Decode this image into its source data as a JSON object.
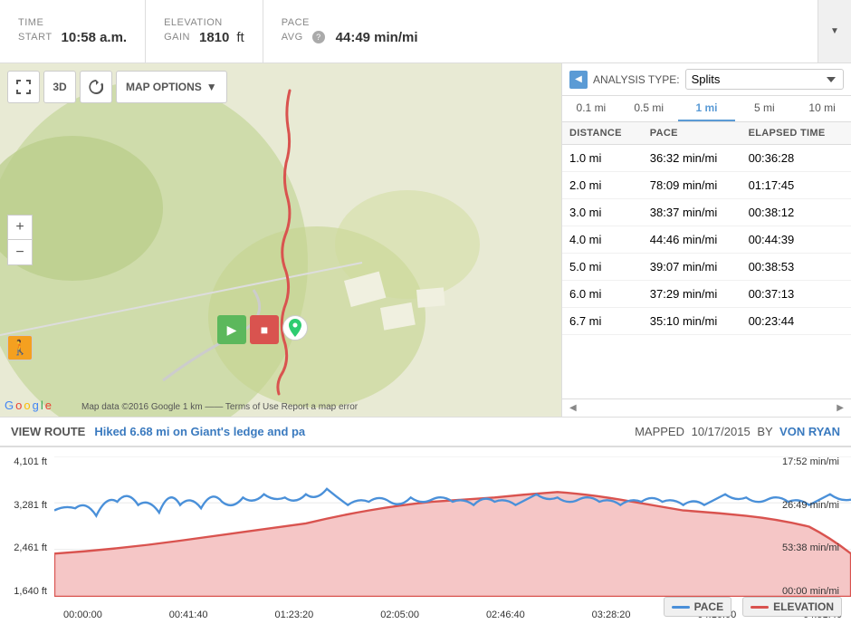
{
  "header": {
    "time_label": "TIME",
    "start_label": "START",
    "start_value": "10:58 a.m.",
    "elevation_label": "ELEVATION",
    "gain_label": "GAIN",
    "gain_value": "1810",
    "gain_unit": "ft",
    "pace_label": "PACE",
    "avg_label": "AVG",
    "avg_value": "44:49 min/mi"
  },
  "map": {
    "options_label": "MAP OPTIONS",
    "copyright": "Map data ©2016 Google   1 km ——   Terms of Use   Report a map error"
  },
  "splits": {
    "title": "Splits",
    "analysis_label": "ANALYSIS TYPE:",
    "tabs": [
      "0.1 mi",
      "0.5 mi",
      "1 mi",
      "5 mi",
      "10 mi"
    ],
    "active_tab": 2,
    "columns": [
      "DISTANCE",
      "PACE",
      "ELAPSED TIME"
    ],
    "rows": [
      {
        "distance": "1.0 mi",
        "pace": "36:32 min/mi",
        "elapsed": "00:36:28"
      },
      {
        "distance": "2.0 mi",
        "pace": "78:09 min/mi",
        "elapsed": "01:17:45"
      },
      {
        "distance": "3.0 mi",
        "pace": "38:37 min/mi",
        "elapsed": "00:38:12"
      },
      {
        "distance": "4.0 mi",
        "pace": "44:46 min/mi",
        "elapsed": "00:44:39"
      },
      {
        "distance": "5.0 mi",
        "pace": "39:07 min/mi",
        "elapsed": "00:38:53"
      },
      {
        "distance": "6.0 mi",
        "pace": "37:29 min/mi",
        "elapsed": "00:37:13"
      },
      {
        "distance": "6.7 mi",
        "pace": "35:10 min/mi",
        "elapsed": "00:23:44"
      }
    ]
  },
  "route_info": {
    "view_label": "VIEW ROUTE",
    "route_name": "Hiked 6.68 mi on Giant's ledge and pa",
    "mapped_label": "MAPPED",
    "mapped_date": "10/17/2015",
    "by_label": "BY",
    "author": "VON RYAN"
  },
  "chart": {
    "y_labels_left": [
      "4,101 ft",
      "3,281 ft",
      "2,461 ft",
      "1,640 ft"
    ],
    "y_labels_right": [
      "17:52 min/mi",
      "26:49 min/mi",
      "53:38 min/mi",
      "00:00 min/mi"
    ],
    "x_labels": [
      "00:00:00",
      "00:41:40",
      "01:23:20",
      "02:05:00",
      "02:46:40",
      "03:28:20",
      "04:10:00",
      "04:51:40"
    ],
    "legend": [
      {
        "label": "PACE",
        "color": "#4a90d9"
      },
      {
        "label": "ELEVATION",
        "color": "#d9534f"
      }
    ]
  },
  "scrollbar": {
    "left_arrow": "◀",
    "right_arrow": "▶"
  }
}
